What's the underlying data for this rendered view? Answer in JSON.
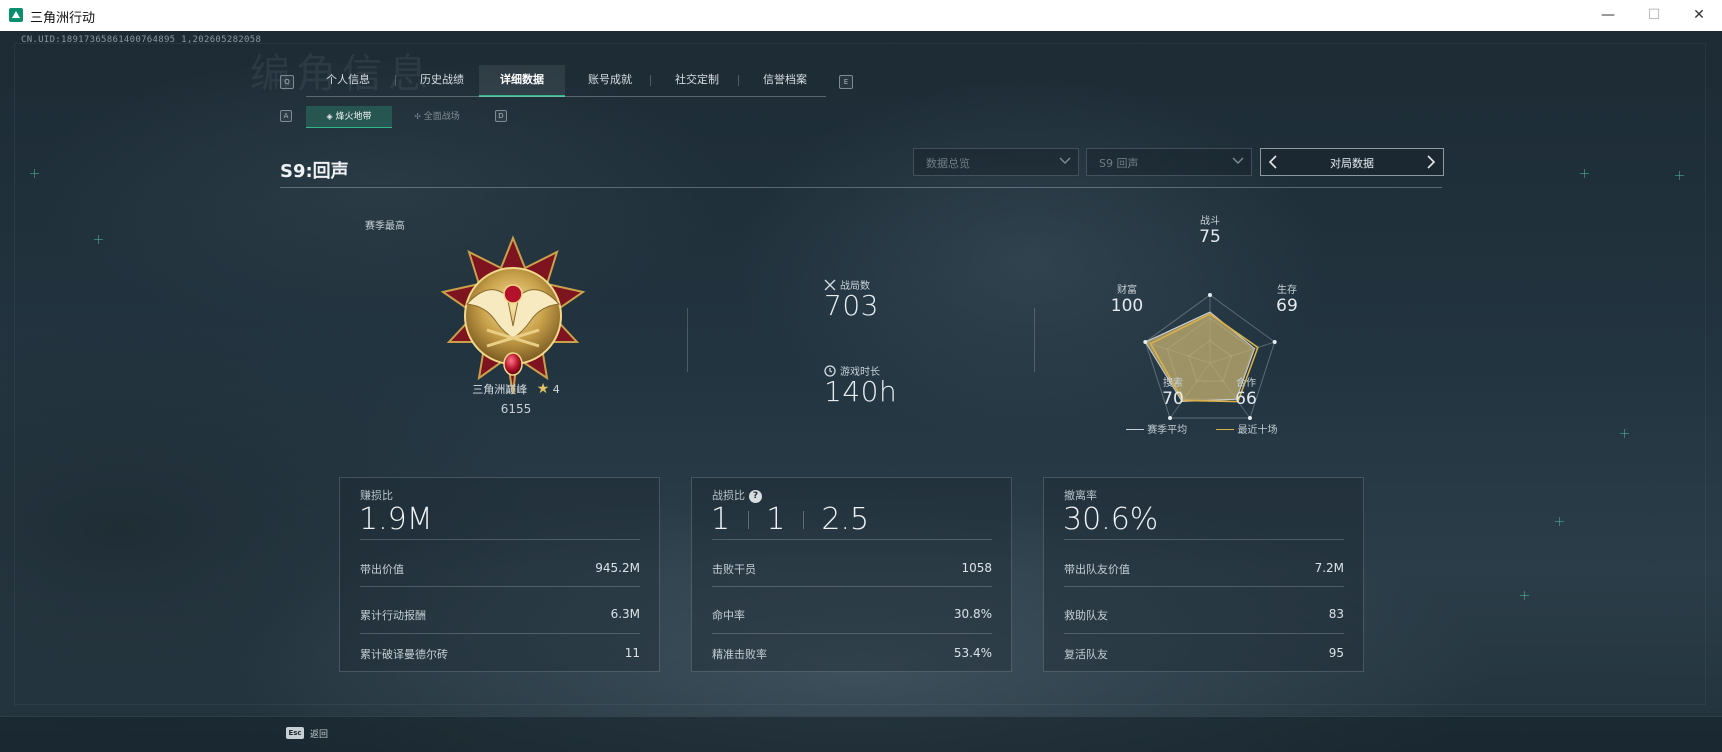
{
  "window": {
    "title": "三角洲行动",
    "minimize": "—",
    "maximize": "☐",
    "close": "✕"
  },
  "uid": "CN.UID:18917365861400764895 1,202605282058",
  "page_heading": "编角信息",
  "main_tabs": [
    {
      "label": "个人信息",
      "key": "Q"
    },
    {
      "label": "历史战绩"
    },
    {
      "label": "详细数据",
      "active": true
    },
    {
      "label": "账号成就"
    },
    {
      "label": "社交定制"
    },
    {
      "label": "信誉档案",
      "key": "E"
    }
  ],
  "key_hints": {
    "tabs_left": "Q",
    "tabs_right": "E",
    "sub_left": "A",
    "sub_right": "D"
  },
  "sub_tabs": [
    {
      "label": "烽火地带",
      "icon": "flame-mode-icon",
      "active": true
    },
    {
      "label": "全面战场",
      "icon": "battlefield-mode-icon"
    }
  ],
  "season": "S9:回声",
  "filters": {
    "data_scope": "数据总览",
    "season_select": "S9 回声",
    "match_data": "对局数据"
  },
  "rank": {
    "caption": "赛季最高",
    "name": "三角洲巅峰",
    "stars": "4",
    "score": "6155"
  },
  "stats": {
    "matches_label": "战局数",
    "matches_value": "703",
    "playtime_label": "游戏时长",
    "playtime_value": "140h"
  },
  "radar": {
    "axes": [
      {
        "label": "战斗",
        "value": "75"
      },
      {
        "label": "生存",
        "value": "69"
      },
      {
        "label": "合作",
        "value": "66"
      },
      {
        "label": "搜索",
        "value": "70"
      },
      {
        "label": "财富",
        "value": "100"
      }
    ],
    "season_values": [
      75,
      69,
      66,
      70,
      100
    ],
    "recent_values": [
      72,
      74,
      70,
      68,
      92
    ],
    "legend_season": "赛季平均",
    "legend_recent": "最近十场",
    "colors": {
      "season": "#c9d1d6",
      "recent": "#d9b04a",
      "fill": "#c6b272"
    }
  },
  "cards": [
    {
      "label": "赚损比",
      "value": "1.9M",
      "rows": [
        {
          "label": "带出价值",
          "value": "945.2M"
        },
        {
          "label": "累计行动报酬",
          "value": "6.3M"
        },
        {
          "label": "累计破译曼德尔砖",
          "value": "11"
        }
      ]
    },
    {
      "label": "战损比",
      "help": "?",
      "kd": [
        "1",
        "1",
        "2.5"
      ],
      "rows": [
        {
          "label": "击败干员",
          "value": "1058"
        },
        {
          "label": "命中率",
          "value": "30.8%"
        },
        {
          "label": "精准击败率",
          "value": "53.4%"
        }
      ]
    },
    {
      "label": "撤离率",
      "value": "30.6%",
      "rows": [
        {
          "label": "带出队友价值",
          "value": "7.2M"
        },
        {
          "label": "救助队友",
          "value": "83"
        },
        {
          "label": "复活队友",
          "value": "95"
        }
      ]
    }
  ],
  "footer": {
    "esc_key": "Esc",
    "back_label": "返回"
  },
  "colors": {
    "accent": "#34b58a",
    "gold": "#d9b04a"
  }
}
